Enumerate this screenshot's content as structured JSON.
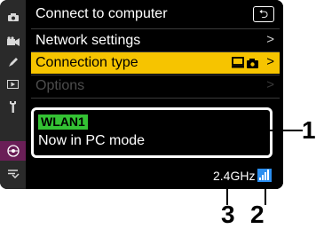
{
  "sidebar": {
    "icons": [
      "camera-icon",
      "movie-camera-icon",
      "pencil-icon",
      "playback-icon",
      "wrench-icon",
      "network-icon",
      "my-menu-icon"
    ],
    "active_index": 5
  },
  "header": {
    "title": "Connect to computer",
    "back_label": "⮌"
  },
  "menu": {
    "items": [
      {
        "label": "Network settings",
        "chevron": ">"
      },
      {
        "label": "Connection type",
        "chevron": ">",
        "value_icons": "▣◘"
      },
      {
        "label": "Options",
        "chevron": ">"
      }
    ]
  },
  "status": {
    "profile": "WLAN1",
    "message": "Now in PC mode"
  },
  "indicators": {
    "band": "2.4GHz",
    "signal": "full"
  },
  "callouts": [
    "1",
    "2",
    "3"
  ],
  "colors": {
    "selected": "#f6c400",
    "profile_tag": "#34c234",
    "active_tab": "#6a1f57",
    "signal": "#2a8ef0"
  }
}
